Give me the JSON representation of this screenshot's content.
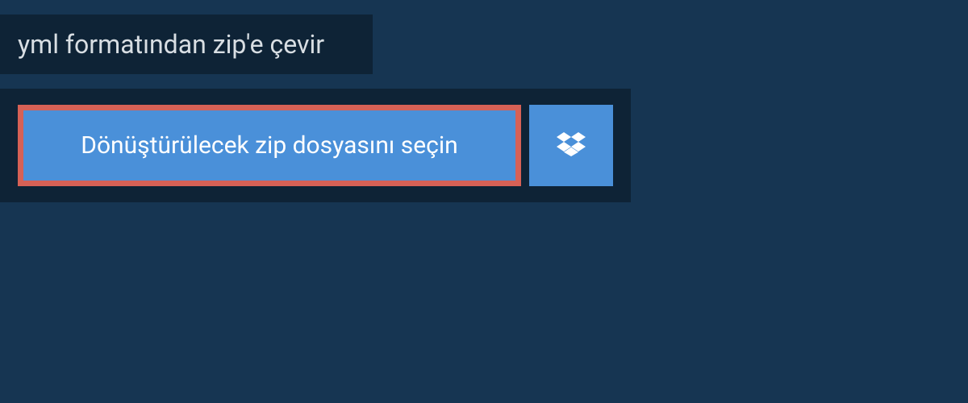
{
  "header": {
    "title": "yml formatından zip'e çevir"
  },
  "actions": {
    "select_file_label": "Dönüştürülecek zip dosyasını seçin",
    "dropbox_icon": "dropbox-icon"
  },
  "colors": {
    "page_bg": "#163552",
    "panel_bg": "#0e2336",
    "button_bg": "#4a90d9",
    "button_border": "#d66156",
    "text_light": "#d8dee3",
    "text_white": "#ffffff"
  }
}
